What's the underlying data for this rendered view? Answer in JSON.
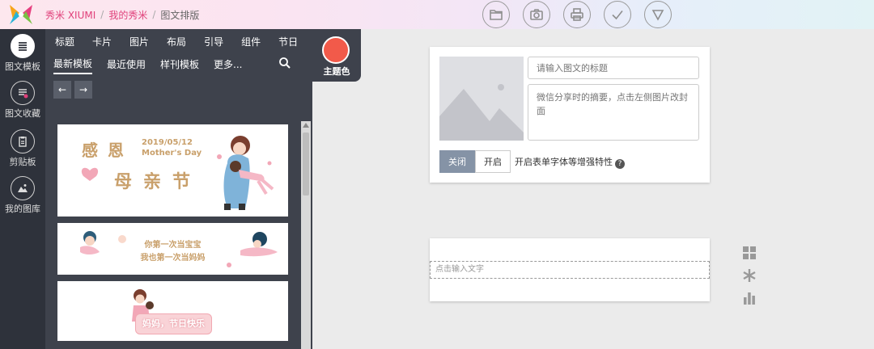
{
  "brand": {
    "name": "秀米 XIUMI"
  },
  "breadcrumb": [
    "我的秀米",
    "图文排版"
  ],
  "toolbar": {
    "icons": [
      "folder-icon",
      "camera-icon",
      "print-icon",
      "check-icon",
      "dropdown-icon"
    ]
  },
  "leftnav": {
    "items": [
      {
        "label": "图文模板",
        "icon": "list-icon",
        "active": true
      },
      {
        "label": "图文收藏",
        "icon": "favorites-icon"
      },
      {
        "label": "剪贴板",
        "icon": "clipboard-icon"
      },
      {
        "label": "我的图库",
        "icon": "gallery-icon"
      }
    ]
  },
  "panel": {
    "categories": [
      "标题",
      "卡片",
      "图片",
      "布局",
      "引导",
      "组件",
      "节日"
    ],
    "subtabs": [
      "最新模板",
      "最近使用",
      "样刊模板",
      "更多..."
    ],
    "cards": [
      {
        "title_left": "感恩",
        "date": "2019/05/12",
        "subtitle": "Mother's Day",
        "main": "母亲节"
      },
      {
        "line1": "你第一次当宝宝",
        "line2": "我也第一次当妈妈"
      },
      {
        "banner": "妈妈，节日快乐"
      }
    ]
  },
  "theme": {
    "label": "主题色",
    "color": "#f25a4a"
  },
  "editor": {
    "title_placeholder": "请输入图文的标题",
    "summary_placeholder": "微信分享时的摘要，点击左侧图片改封面",
    "toggle_off": "关闭",
    "toggle_on": "开启",
    "toggle_label": "开启表单字体等增强特性"
  },
  "text_block": {
    "placeholder": "点击输入文字"
  },
  "colors": {
    "accent": "#e0407a",
    "panel_bg": "#3e424c",
    "nav_bg": "#2e323b",
    "toggle_active": "#8593a6"
  }
}
